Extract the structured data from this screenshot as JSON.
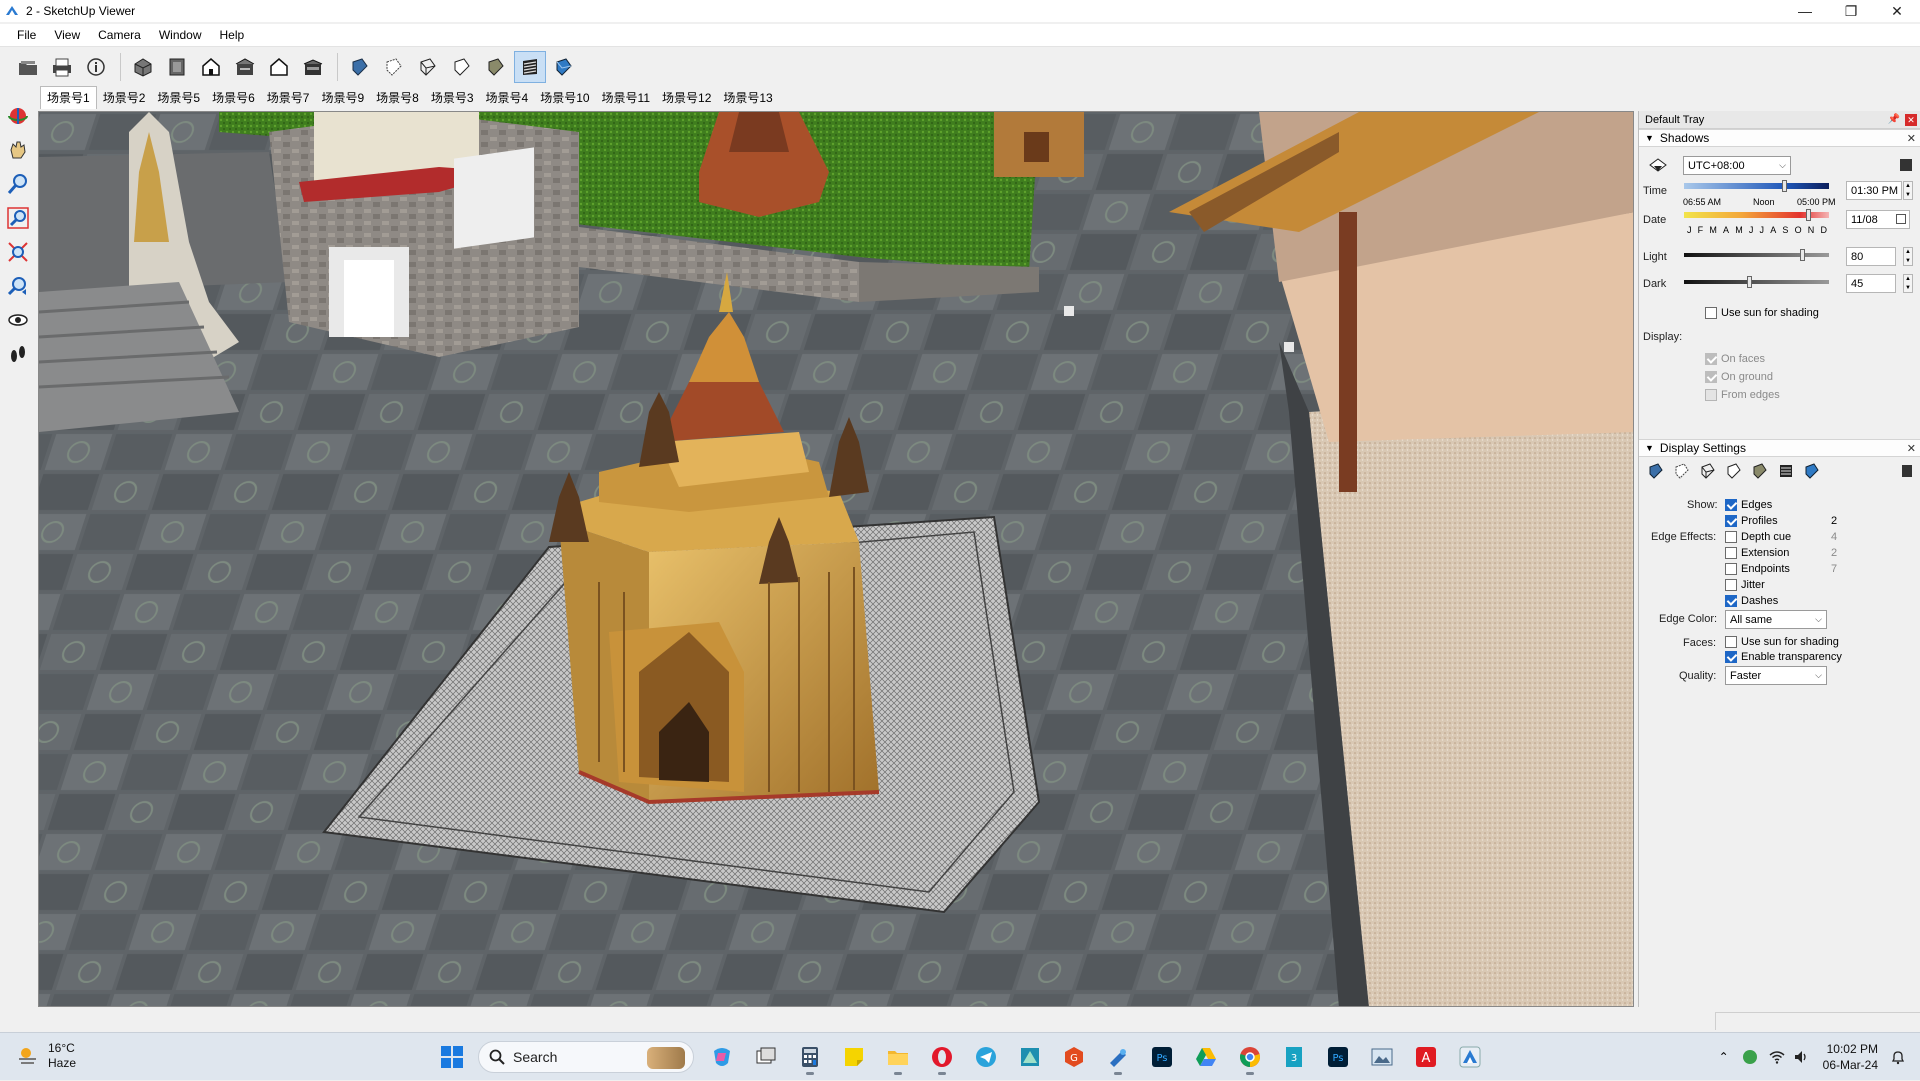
{
  "window": {
    "title": "2 - SketchUp Viewer",
    "controls": {
      "minimize": "—",
      "maximize": "❐",
      "close": "✕"
    }
  },
  "menu": [
    "File",
    "View",
    "Camera",
    "Window",
    "Help"
  ],
  "scene_tabs": [
    "场景号1",
    "场景号2",
    "场景号5",
    "场景号6",
    "场景号7",
    "场景号9",
    "场景号8",
    "场景号3",
    "场景号4",
    "场景号10",
    "场景号11",
    "场景号12",
    "场景号13"
  ],
  "tray": {
    "title": "Default Tray",
    "shadows": {
      "header": "Shadows",
      "timezone": "UTC+08:00",
      "time_label": "Time",
      "time_marks": [
        "06:55 AM",
        "Noon",
        "05:00 PM"
      ],
      "time_value": "01:30 PM",
      "date_label": "Date",
      "months": [
        "J",
        "F",
        "M",
        "A",
        "M",
        "J",
        "J",
        "A",
        "S",
        "O",
        "N",
        "D"
      ],
      "date_value": "11/08",
      "light_label": "Light",
      "light_value": "80",
      "dark_label": "Dark",
      "dark_value": "45",
      "use_sun_label": "Use sun for shading",
      "display_label": "Display:",
      "on_faces": "On faces",
      "on_ground": "On ground",
      "from_edges": "From edges"
    },
    "display": {
      "header": "Display Settings",
      "show_label": "Show:",
      "edge_effects_label": "Edge Effects:",
      "edges": "Edges",
      "profiles": "Profiles",
      "profiles_val": "2",
      "depth_cue": "Depth cue",
      "depth_cue_val": "4",
      "extension": "Extension",
      "extension_val": "2",
      "endpoints": "Endpoints",
      "endpoints_val": "7",
      "jitter": "Jitter",
      "dashes": "Dashes",
      "edge_color_label": "Edge Color:",
      "edge_color_value": "All same",
      "faces_label": "Faces:",
      "faces_use_sun": "Use sun for shading",
      "enable_transparency": "Enable transparency",
      "quality_label": "Quality:",
      "quality_value": "Faster"
    }
  },
  "taskbar": {
    "weather_temp": "16°C",
    "weather_cond": "Haze",
    "search_placeholder": "Search",
    "time": "10:02 PM",
    "date": "06-Mar-24"
  },
  "colors": {
    "accent": "#1e67c6",
    "close_red": "#d62b2b",
    "taskbar": "#dfe6ee"
  }
}
